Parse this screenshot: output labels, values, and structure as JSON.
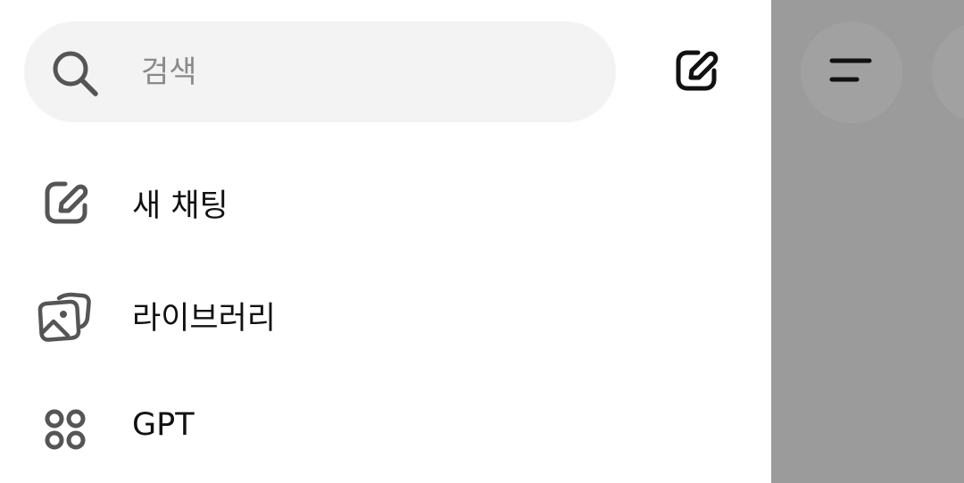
{
  "search": {
    "placeholder": "검색",
    "icon": "search-icon"
  },
  "header": {
    "compose_icon": "compose-icon"
  },
  "menu": {
    "items": [
      {
        "label": "새 채팅",
        "icon": "new-chat-icon"
      },
      {
        "label": "라이브러리",
        "icon": "library-icon"
      },
      {
        "label": "GPT",
        "icon": "gpt-grid-icon"
      }
    ]
  },
  "main": {
    "menu_icon": "hamburger-icon",
    "scrim_color": "#9b9b9b"
  },
  "colors": {
    "search_bg": "#f3f3f3",
    "icon": "#555555",
    "text": "#111111"
  }
}
